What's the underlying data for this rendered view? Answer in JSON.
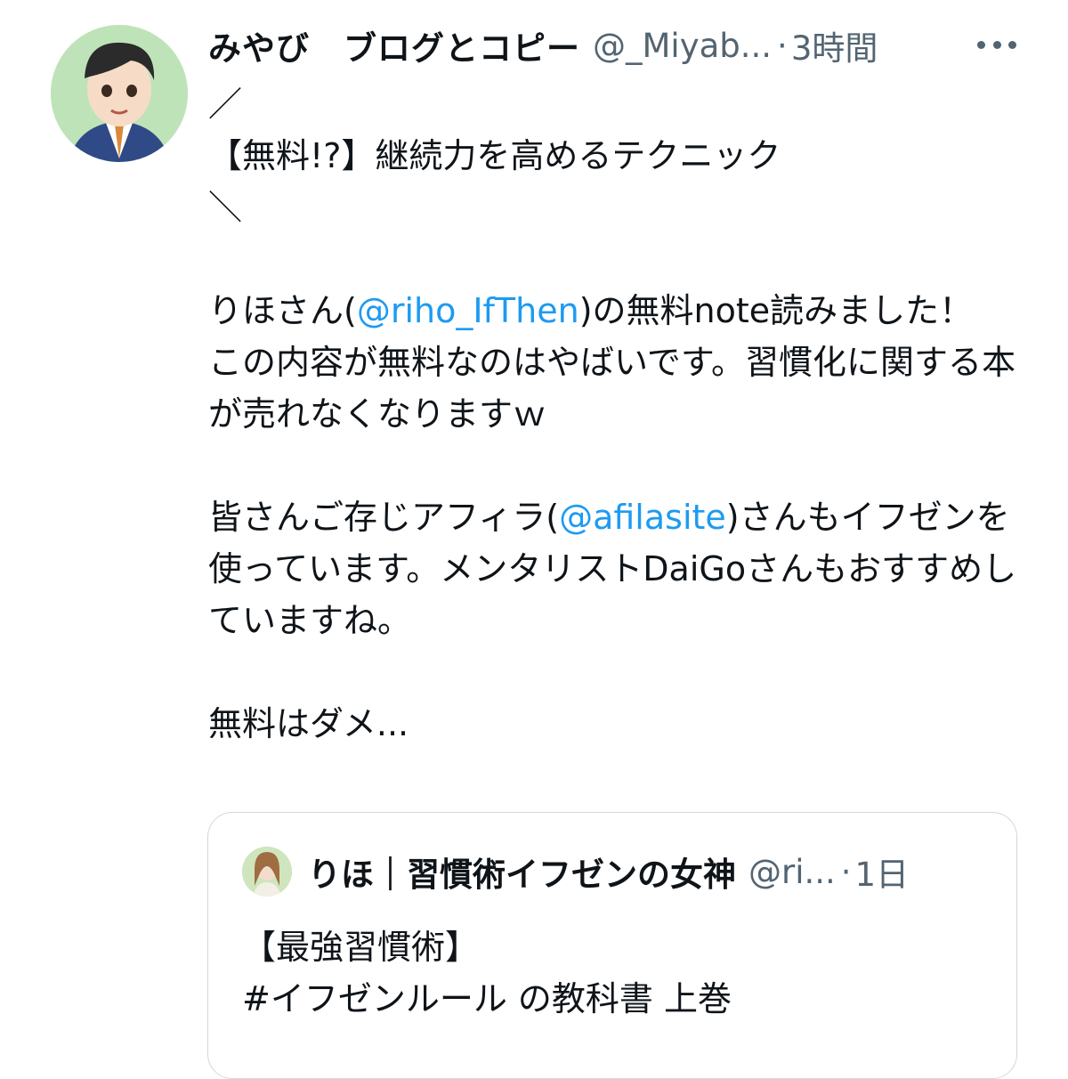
{
  "tweet": {
    "author_name": "みやび　ブログとコピー",
    "author_handle": "@_Miyab...",
    "separator": "·",
    "timestamp": "3時間",
    "line1": "／",
    "line2": "【無料!?】継続力を高めるテクニック",
    "line3": "＼",
    "p1_a": "りほさん(",
    "mention1": "@riho_IfThen",
    "p1_b": ")の無料note読みました！\nこの内容が無料なのはやばいです。習慣化に関する本が売れなくなりますｗ",
    "p2_a": "皆さんご存じアフィラ(",
    "mention2": "@afilasite",
    "p2_b": ")さんもイフゼンを使っています。メンタリストDaiGoさんもおすすめしていますね。",
    "p3": "無料はダメ..."
  },
  "quoted_tweet": {
    "author_name": "りほ｜習慣術イフゼンの女神",
    "author_handle": "@ri...",
    "separator": "·",
    "timestamp": "1日",
    "line1": "【最強習慣術】",
    "line2": "#イフゼンルール の教科書 上巻"
  },
  "icons": {
    "more": "more-horizontal-icon"
  },
  "colors": {
    "mention": "#1d9bf0",
    "secondary_text": "#536471",
    "border": "#cfd9de"
  }
}
